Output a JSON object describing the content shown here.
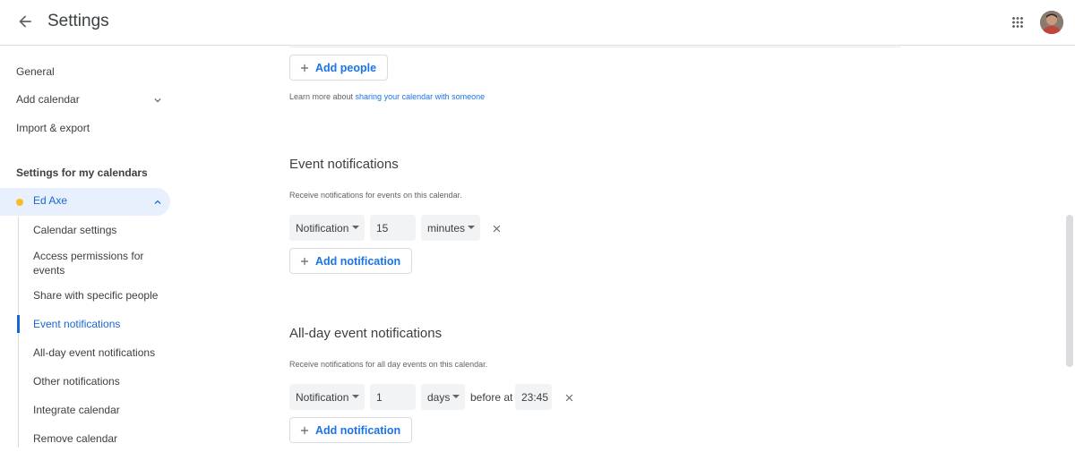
{
  "header": {
    "title": "Settings",
    "back_icon": "arrow-back-icon",
    "apps_icon": "apps-grid-icon"
  },
  "sidebar": {
    "general": "General",
    "add_calendar": "Add calendar",
    "import_export": "Import & export",
    "my_calendars_heading": "Settings for my calendars",
    "calendar": {
      "name": "Ed Axe",
      "color": "#f6bf26"
    },
    "sub_items": [
      "Calendar settings",
      "Access permissions for events",
      "Share with specific people",
      "Event notifications",
      "All-day event notifications",
      "Other notifications",
      "Integrate calendar",
      "Remove calendar"
    ],
    "active_index": 3
  },
  "main": {
    "add_people_label": "Add people",
    "learn_prefix": "Learn more about ",
    "learn_link": "sharing your calendar with someone",
    "event_notifications": {
      "title": "Event notifications",
      "description": "Receive notifications for events on this calendar.",
      "method": "Notification",
      "amount": "15",
      "unit": "minutes",
      "add_label": "Add notification"
    },
    "allday_notifications": {
      "title": "All-day event notifications",
      "description": "Receive notifications for all day events on this calendar.",
      "method": "Notification",
      "amount": "1",
      "unit": "days",
      "before_at": "before at",
      "time": "23:45",
      "add_label": "Add notification"
    }
  },
  "colors": {
    "accent": "#1a73e8",
    "active_text": "#1967d2",
    "active_bg": "#e8f0fe",
    "field_bg": "#f1f3f4"
  }
}
